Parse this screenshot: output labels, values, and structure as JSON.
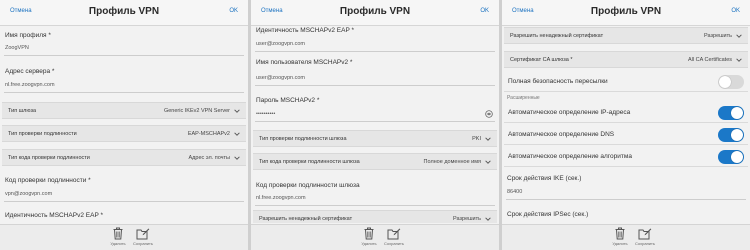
{
  "header": {
    "cancel": "Отмена",
    "title": "Профиль VPN",
    "ok": "OK"
  },
  "footer": {
    "delete": "Удалить",
    "save": "Сохранить"
  },
  "panel1": {
    "profile_name_label": "Имя профиля *",
    "profile_name_value": "ZoogVPN",
    "server_address_label": "Адрес сервера *",
    "server_address_value": "nl.free.zoogvpn.com",
    "gateway_type_label": "Тип шлюза",
    "gateway_type_value": "Generic IKEv2 VPN Server",
    "auth_type_label": "Тип проверки подлинности",
    "auth_type_value": "EAP-MSCHAPv2",
    "auth_id_type_label": "Тип кода проверки подлинности",
    "auth_id_type_value": "Адрес эл. почты",
    "auth_id_label": "Код проверки подлинности *",
    "auth_id_value": "vpn@zoogvpn.com",
    "mschap_id_label": "Идентичность MSCHAPv2 EAP *"
  },
  "panel2": {
    "mschap_id_label": "Идентичность MSCHAPv2 EAP *",
    "mschap_id_value": "user@zoogvpn.com",
    "mschap_user_label": "Имя пользователя MSCHAPv2 *",
    "mschap_user_value": "user@zoogvpn.com",
    "mschap_pass_label": "Пароль MSCHAPv2 *",
    "mschap_pass_value": "••••••••••",
    "gw_auth_type_label": "Тип проверки подлинности шлюза",
    "gw_auth_type_value": "PKI",
    "gw_auth_id_type_label": "Тип кода проверки подлинности шлюза",
    "gw_auth_id_type_value": "Полное доменное имя",
    "gw_auth_id_label": "Код проверки подлинности шлюза",
    "gw_auth_id_value": "nl.free.zoogvpn.com",
    "untrusted_cert_label": "Разрешить ненадежный сертификат",
    "untrusted_cert_value": "Разрешить"
  },
  "panel3": {
    "untrusted_cert_label": "Разрешить ненадежный сертификат",
    "untrusted_cert_value": "Разрешить",
    "ca_cert_label": "Сертификат CA шлюза *",
    "ca_cert_value": "All CA Certificates",
    "pfs_label": "Полная безопасность пересылки",
    "advanced_label": "Расширенные",
    "auto_ip_label": "Автоматическое определение IP-адреса",
    "auto_dns_label": "Автоматическое определение DNS",
    "auto_algo_label": "Автоматическое определение алгоритма",
    "ike_lifetime_label": "Срок действия IKE (сек.)",
    "ike_lifetime_value": "86400",
    "ipsec_lifetime_label": "Срок действия IPSec (сек.)"
  },
  "toggles": {
    "pfs": false,
    "auto_ip": true,
    "auto_dns": true,
    "auto_algo": true
  },
  "colors": {
    "accent": "#1b78c8",
    "link": "#1b72c0"
  },
  "icons": [
    "trash-icon",
    "save-icon",
    "chevron-down-icon",
    "eye-icon"
  ]
}
